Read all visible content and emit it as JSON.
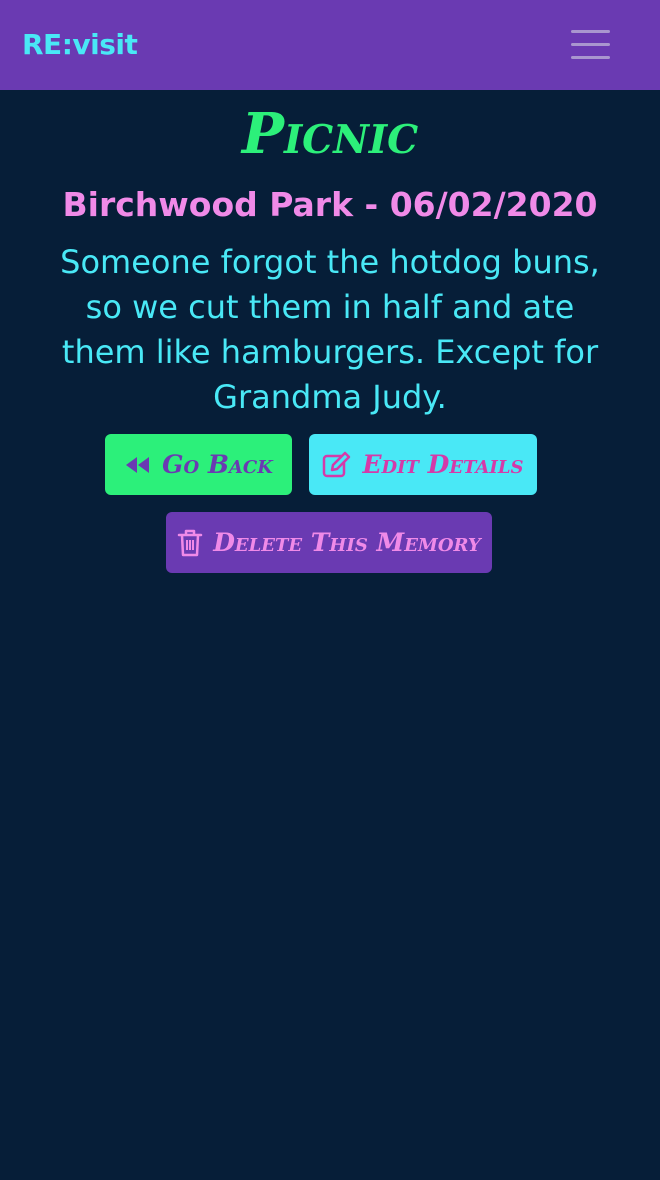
{
  "navbar": {
    "brand": "RE:visit",
    "menu_icon": "hamburger-menu-icon"
  },
  "memory": {
    "title": "Picnic",
    "subtitle": "Birchwood Park - 06/02/2020",
    "description": "Someone forgot the hotdog buns, so we cut them in half and ate them like hamburgers. Except for Grandma Judy."
  },
  "actions": {
    "back": {
      "label": "Go Back",
      "icon": "backward-icon"
    },
    "edit": {
      "label": "Edit Details",
      "icon": "edit-icon"
    },
    "delete": {
      "label": "Delete This Memory",
      "icon": "trash-icon"
    }
  },
  "colors": {
    "background": "#061e38",
    "navbar": "#6a3ab2",
    "brand": "#49e8f6",
    "title": "#2cf07a",
    "subtitle": "#f08ae8",
    "description": "#49e8f6"
  }
}
